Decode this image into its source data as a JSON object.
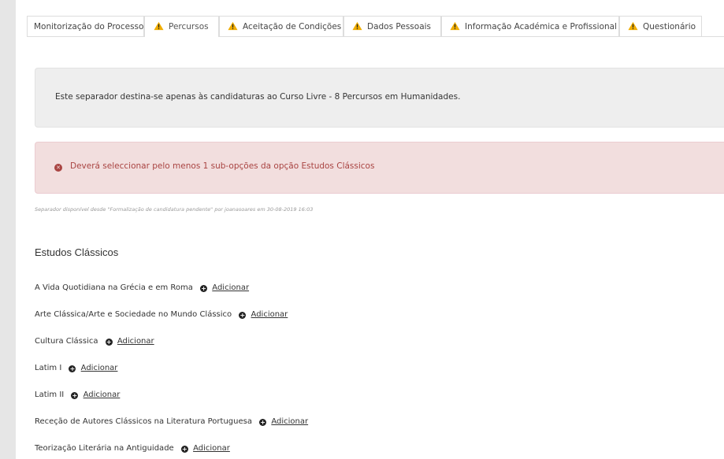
{
  "tabs": [
    {
      "label": "Monitorização do Processo",
      "warning": false
    },
    {
      "label": "Percursos",
      "warning": true,
      "active": true
    },
    {
      "label": "Aceitação de Condições",
      "warning": true
    },
    {
      "label": "Dados Pessoais",
      "warning": true
    },
    {
      "label": "Informação Académica e Profissional",
      "warning": true
    },
    {
      "label": "Questionário",
      "warning": true
    }
  ],
  "info": {
    "text": "Este separador destina-se apenas às candidaturas ao Curso Livre - 8 Percursos em Humanidades."
  },
  "alert": {
    "text": "Deverá seleccionar pelo menos 1 sub-opções da opção Estudos Clássicos"
  },
  "meta": {
    "text": "Separador disponível desde \"Formalização de candidatura pendente\" por joanasoares em 30-08-2019 16:03"
  },
  "section": {
    "title": "Estudos Clássicos",
    "add_label": "Adicionar",
    "courses": [
      "A Vida Quotidiana na Grécia e em Roma",
      "Arte Clássica/Arte e Sociedade no Mundo Clássico",
      "Cultura Clássica",
      "Latim I",
      "Latim II",
      "Receção de Autores Clássicos na Literatura Portuguesa",
      "Teorização Literária na Antiguidade"
    ]
  },
  "colors": {
    "warning": "#f0ad00",
    "alert_bg": "#f2dede",
    "alert_text": "#a94442",
    "info_bg": "#eeeeee"
  },
  "icons": {
    "warning": "warning-triangle-icon",
    "alert": "error-circle-icon",
    "add": "plus-circle-icon"
  }
}
